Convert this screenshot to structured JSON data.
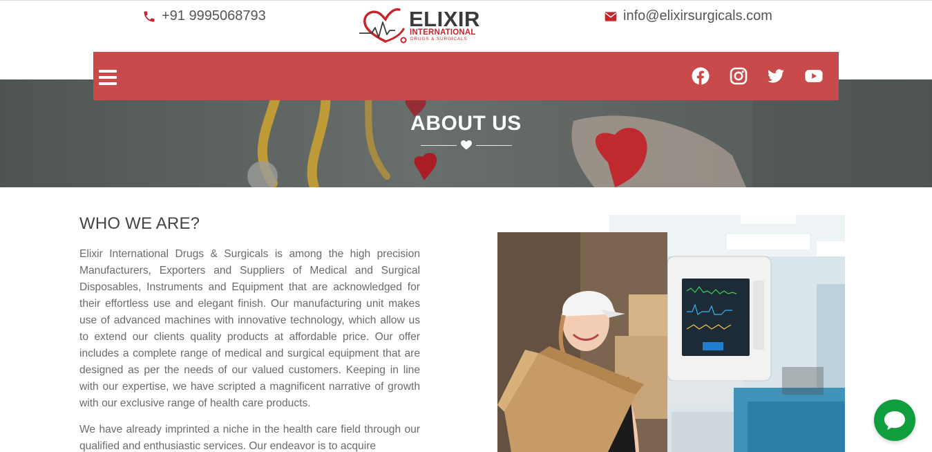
{
  "header": {
    "phone": "+91 9995068793",
    "email": "info@elixirsurgicals.com",
    "logo": {
      "name": "ELIXIR",
      "sub": "INTERNATIONAL",
      "tagline": "DRUGS & SURGICALS"
    }
  },
  "nav": {
    "menu_icon": "hamburger-menu-icon",
    "social": [
      "facebook-icon",
      "instagram-icon",
      "twitter-icon",
      "youtube-icon"
    ]
  },
  "hero": {
    "title": "ABOUT US"
  },
  "about": {
    "heading": "WHO WE ARE?",
    "paragraphs": [
      "Elixir International Drugs & Surgicals is among the high precision Manufacturers, Exporters and Suppliers of Medical and Surgical Disposables, Instruments and Equipment that are acknowledged for their effortless use and elegant finish. Our manufacturing unit makes use of advanced machines with innovative technology, which allow us to extend our clients quality products at affordable price. Our offer includes a complete range of medical and surgical equipment that are designed as per the needs of our valued customers. Keeping in line with our expertise, we have scripted a magnificent narrative of growth with our exclusive range of health care products.",
      "We have already imprinted a niche in the health care field through our qualified and enthusiastic services. Our endeavor is to acquire"
    ]
  },
  "colors": {
    "brand_red": "#c94a4b",
    "logo_red": "#c7242b",
    "chat_green": "#0f9d3e",
    "text_gray": "#6a6a6a"
  },
  "chat": {
    "icon": "chat-bubble-icon"
  }
}
